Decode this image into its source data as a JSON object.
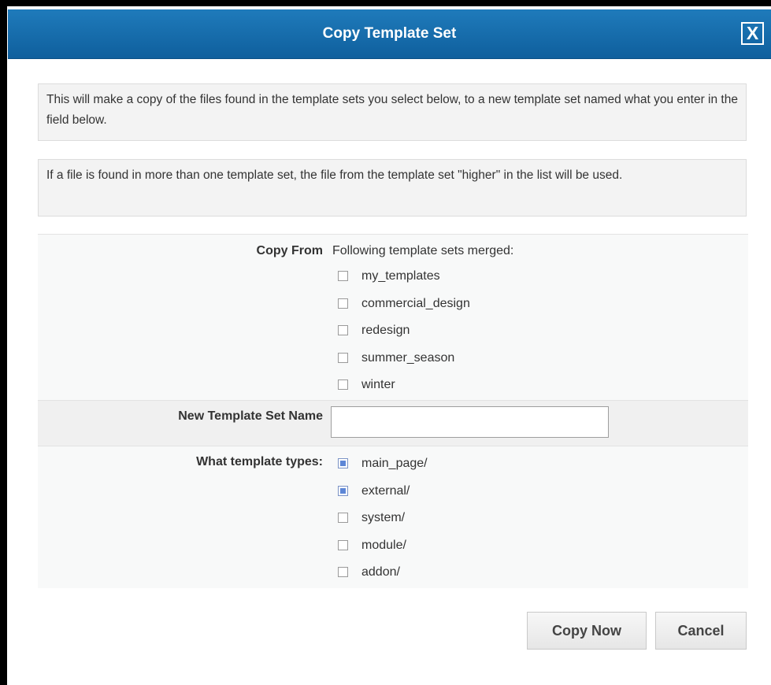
{
  "dialog": {
    "title": "Copy Template Set",
    "close_label": "X"
  },
  "notices": [
    "This will make a copy of the files found in the template sets you select below, to a new template set named what you enter in the field below.",
    "If a file is found in more than one template set, the file from the template set \"higher\" in the list will be used."
  ],
  "copy_from": {
    "label": "Copy From",
    "note": "Following template sets merged:",
    "items": [
      {
        "label": "my_templates",
        "checked": false
      },
      {
        "label": "commercial_design",
        "checked": false
      },
      {
        "label": "redesign",
        "checked": false
      },
      {
        "label": "summer_season",
        "checked": false
      },
      {
        "label": "winter",
        "checked": false
      }
    ]
  },
  "new_name": {
    "label": "New Template Set Name",
    "value": "",
    "placeholder": ""
  },
  "template_types": {
    "label": "What template types:",
    "items": [
      {
        "label": "main_page/",
        "checked": true
      },
      {
        "label": "external/",
        "checked": true
      },
      {
        "label": "system/",
        "checked": false
      },
      {
        "label": "module/",
        "checked": false
      },
      {
        "label": "addon/",
        "checked": false
      }
    ]
  },
  "buttons": {
    "copy_now": "Copy Now",
    "cancel": "Cancel"
  }
}
